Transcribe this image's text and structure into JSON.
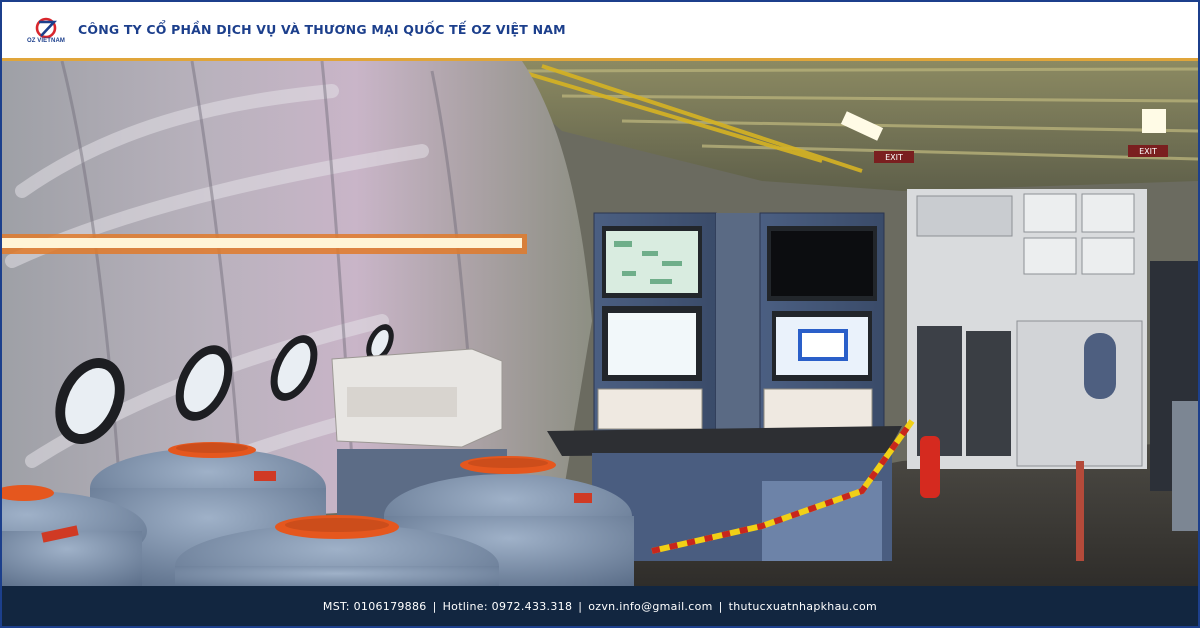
{
  "brand": {
    "logo_text": "OZ VIETNAM",
    "company_name": "CÔNG TY CỔ PHẦN DỊCH VỤ VÀ THƯƠNG MẠI QUỐC TẾ OZ VIỆT NAM",
    "primary_color": "#1c3f8c",
    "accent_color": "#e0a53a",
    "logo_red": "#d9262c"
  },
  "hero_image": {
    "content_icon": "aircraft-cabin-test-equipment-photo",
    "exit_signs": [
      "EXIT",
      "EXIT"
    ]
  },
  "footer": {
    "mst": "MST: 0106179886",
    "hotline": "Hotline: 0972.433.318",
    "email": "ozvn.info@gmail.com",
    "website": "thutucxuatnhapkhau.com",
    "separator": "|",
    "background": "#122640"
  }
}
